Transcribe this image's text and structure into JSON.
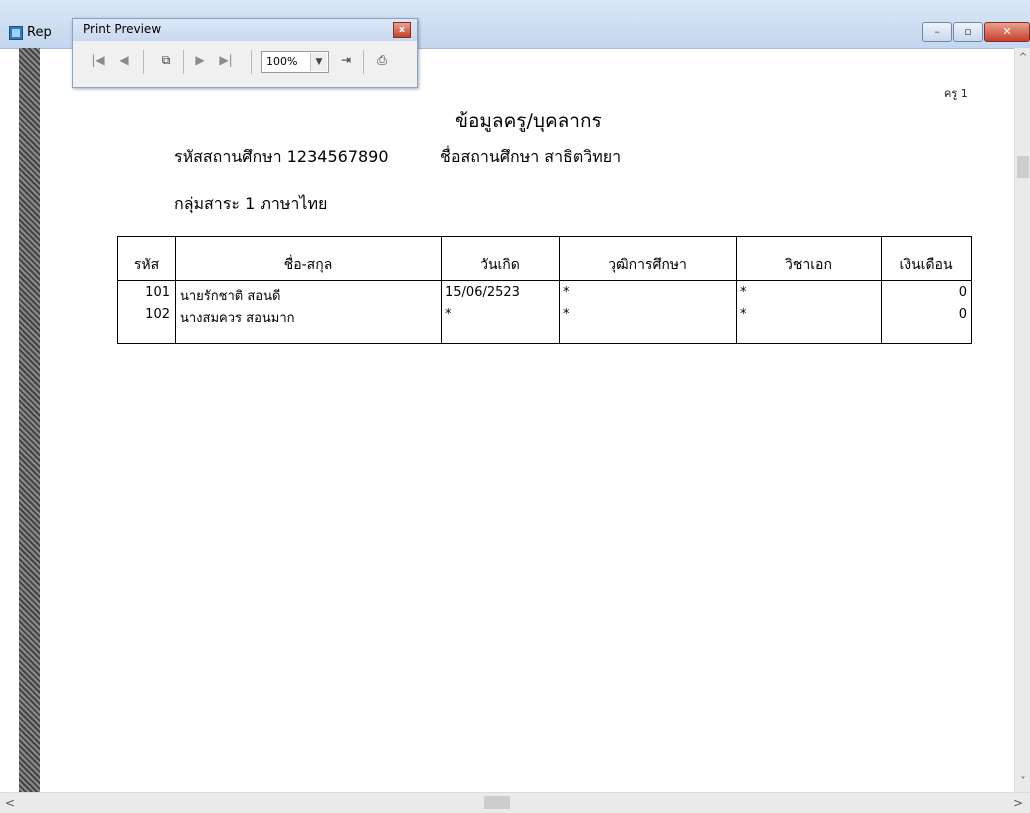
{
  "window": {
    "title": "Rep"
  },
  "print_preview": {
    "title": "Print Preview",
    "zoom": "100%",
    "icons": [
      "first-page-icon",
      "previous-page-icon",
      "multi-page-icon",
      "next-page-icon",
      "last-page-icon",
      "exit-icon",
      "printer-icon"
    ]
  },
  "report": {
    "page_label": "ครู 1",
    "title": "ข้อมูลครู/บุคลากร",
    "school_code": "รหัสสถานศึกษา 1234567890",
    "school_name": "ชื่อสถานศึกษา สาธิตวิทยา",
    "subject_group": "กลุ่มสาระ 1 ภาษาไทย",
    "columns": [
      "รหัส",
      "ชื่อ-สกุล",
      "วันเกิด",
      "วุฒิการศึกษา",
      "วิชาเอก",
      "เงินเดือน"
    ],
    "rows": [
      {
        "id": "101",
        "name": "นายรักชาติ สอนดี",
        "birth": "15/06/2523",
        "degree": "*",
        "major": "*",
        "salary": "0"
      },
      {
        "id": "102",
        "name": "นางสมควร สอนมาก",
        "birth": "*",
        "degree": "*",
        "major": "*",
        "salary": "0"
      }
    ]
  }
}
